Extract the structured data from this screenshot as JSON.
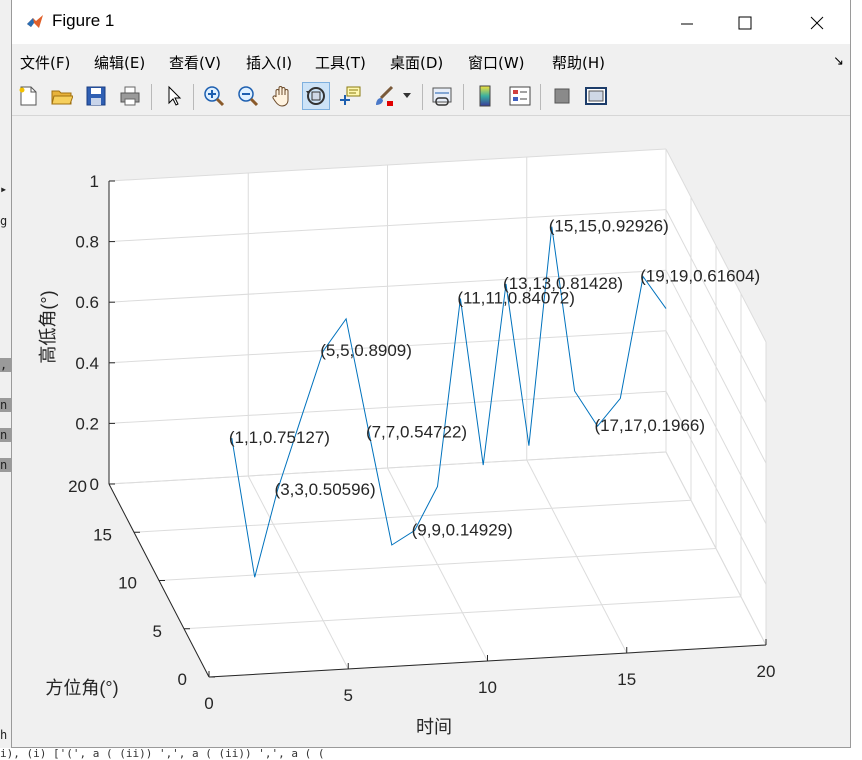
{
  "window": {
    "title": "Figure 1",
    "minimize_glyph": "—",
    "maximize_glyph": "☐",
    "close_glyph": "✕"
  },
  "menu": {
    "items": [
      "文件(F)",
      "编辑(E)",
      "查看(V)",
      "插入(I)",
      "工具(T)",
      "桌面(D)",
      "窗口(W)",
      "帮助(H)"
    ]
  },
  "toolbar": {
    "buttons": [
      "new-figure-icon",
      "open-file-icon",
      "save-icon",
      "print-icon",
      "pointer-icon",
      "zoom-in-icon",
      "zoom-out-icon",
      "pan-hand-icon",
      "rotate-3d-icon",
      "data-cursor-icon",
      "brush-icon",
      "brush-dropdown-icon",
      "link-plot-icon",
      "colorbar-icon",
      "legend-icon",
      "hide-plot-tools-icon",
      "show-plot-tools-icon"
    ],
    "active": "rotate-3d-icon"
  },
  "background_fragments": {
    "bottom_line": "i),  (i) ['(',  a  (  (ii)) ',',  a  (  (ii)) ',',  a  (  (",
    "left_chars": [
      "g",
      ",",
      "n",
      "n",
      "n",
      "h"
    ]
  },
  "chart_data": {
    "type": "line",
    "dimension": "3d",
    "series_color": "#0072bd",
    "x": [
      1,
      2,
      3,
      4,
      5,
      6,
      7,
      8,
      9,
      10,
      11,
      12,
      13,
      14,
      15,
      16,
      17,
      18,
      19,
      20
    ],
    "y": [
      1,
      2,
      3,
      4,
      5,
      6,
      7,
      8,
      9,
      10,
      11,
      12,
      13,
      14,
      15,
      16,
      17,
      18,
      19,
      20
    ],
    "z": [
      0.75127,
      0.2551,
      0.50596,
      0.69908,
      0.8909,
      0.95929,
      0.54722,
      0.13862,
      0.14929,
      0.25751,
      0.84072,
      0.25428,
      0.81428,
      0.24352,
      0.92926,
      0.34998,
      0.1966,
      0.25108,
      0.61604,
      0.47329
    ],
    "xlabel": "时间",
    "ylabel": "方位角(°)",
    "zlabel": "高低角(°)",
    "xlim": [
      0,
      20
    ],
    "ylim": [
      0,
      20
    ],
    "zlim": [
      0,
      1
    ],
    "xticks": [
      "0",
      "5",
      "10",
      "15",
      "20"
    ],
    "yticks": [
      "0",
      "5",
      "10",
      "15",
      "20"
    ],
    "zticks": [
      "0",
      "0.2",
      "0.4",
      "0.6",
      "0.8",
      "1"
    ],
    "grid": true,
    "annotations": [
      {
        "index": 0,
        "text": "(1,1,0.75127)"
      },
      {
        "index": 2,
        "text": "(3,3,0.50596)"
      },
      {
        "index": 4,
        "text": "(5,5,0.8909)"
      },
      {
        "index": 6,
        "text": "(7,7,0.54722)"
      },
      {
        "index": 8,
        "text": "(9,9,0.14929)"
      },
      {
        "index": 10,
        "text": "(11,11,0.84072)"
      },
      {
        "index": 12,
        "text": "(13,13,0.81428)"
      },
      {
        "index": 14,
        "text": "(15,15,0.92926)"
      },
      {
        "index": 16,
        "text": "(17,17,0.1966)"
      },
      {
        "index": 18,
        "text": "(19,19,0.61604)"
      }
    ]
  }
}
